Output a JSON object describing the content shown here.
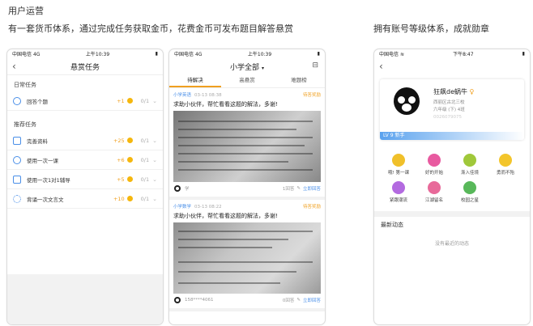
{
  "header": {
    "title": "用户运营"
  },
  "captions": {
    "left": "有一套货币体系，通过完成任务获取金币，花费金币可发布题目解答悬赏",
    "right": "拥有账号等级体系，成就勋章"
  },
  "status_bar": {
    "carrier": "中国电信",
    "network": "4G",
    "time": "上午10:39",
    "time_right": "下午8:47"
  },
  "screen1": {
    "title": "悬赏任务",
    "daily_section": "日常任务",
    "daily": [
      {
        "label": "回答个题",
        "coins": "+1",
        "progress": "0/1"
      }
    ],
    "rec_section": "推荐任务",
    "recommend": [
      {
        "label": "完善资料",
        "coins": "+25",
        "progress": "0/1"
      },
      {
        "label": "使用一次一课",
        "coins": "+6",
        "progress": "0/1"
      },
      {
        "label": "使用一次1对1辅导",
        "coins": "+5",
        "progress": "0/1"
      },
      {
        "label": "背诵一次文言文",
        "coins": "+10",
        "progress": "0/1"
      }
    ]
  },
  "screen2": {
    "title": "小学全部",
    "tabs": [
      "待解决",
      "高悬赏",
      "难题榜"
    ],
    "cards": [
      {
        "subject": "小学英语",
        "time": "03-13 08:38",
        "reward": "待答奖励",
        "title": "求助小伙伴，帮忙看看这题的解法，多谢!",
        "user": "学",
        "count": "1回答",
        "answer_btn": "立即回答"
      },
      {
        "subject": "小学数学",
        "time": "03-13 08:22",
        "reward": "待答奖励",
        "title": "求助小伙伴，帮忙看看这题的解法，多谢!",
        "user": "158****4061",
        "count": "0回答",
        "answer_btn": "立即回答"
      }
    ]
  },
  "screen3": {
    "name": "狂飙de蜗牛",
    "school": "西丽区古北三校",
    "grade": "六年级 (下) 4班",
    "id_text": "0026079075",
    "level": "LV 9",
    "level_sub": "新手",
    "badges": [
      {
        "label": "哦! 第一课",
        "color": "#f0c02a"
      },
      {
        "label": "好的开始",
        "color": "#e85aa0"
      },
      {
        "label": "渐入佳境",
        "color": "#a0c83a"
      },
      {
        "label": "勇而不殆",
        "color": "#f3c52b"
      },
      {
        "label": "紧跟潮流",
        "color": "#b36ae0"
      },
      {
        "label": "江湖留名",
        "color": "#e86a9a"
      },
      {
        "label": "校园之星",
        "color": "#58b85a"
      }
    ],
    "news_title": "最新动态",
    "empty_text": "没有最近的动态"
  }
}
